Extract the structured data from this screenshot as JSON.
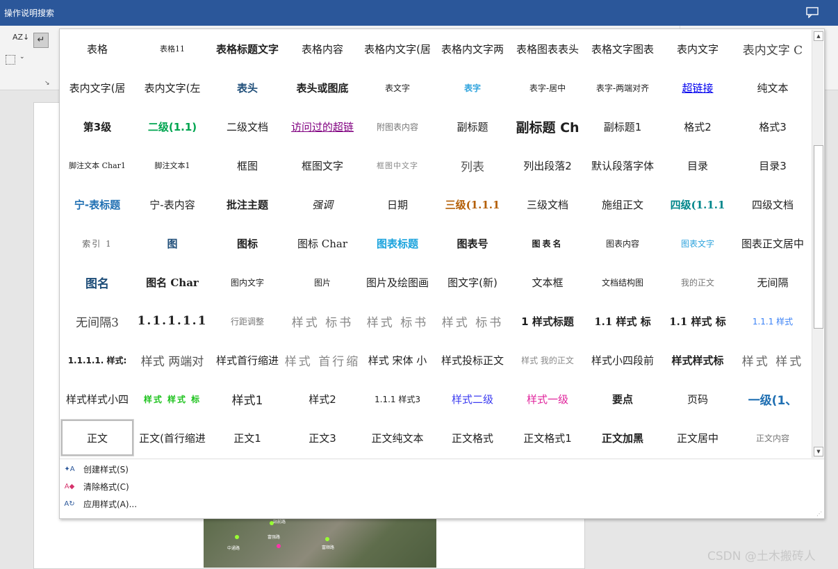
{
  "titlebar": {
    "title": "操作说明搜索",
    "comment_icon": "comment-icon"
  },
  "ribbon": {
    "sort_icon_text": "AZ↓",
    "pilcrow": "↵"
  },
  "colors": {
    "titlebar": "#2b579a",
    "link": "#0000ee",
    "visited": "#800080",
    "teal": "#00868b",
    "blue_heading": "#1f6fb2"
  },
  "styles": [
    "表格",
    "表格11",
    "表格标题文字",
    "表格内容",
    "表格内文字(居",
    "表格内文字两",
    "表格图表表头",
    "表格文字图表",
    "表内文字",
    "表内文字 C",
    "表内文字(居",
    "表内文字(左",
    "表头",
    "表头或图底",
    "表文字",
    "表字",
    "表字-居中",
    "表字-两端对齐",
    "超链接",
    "纯文本",
    "第3级",
    "二级(1.1)",
    "二级文档",
    "访问过的超链",
    "附图表内容",
    "副标题",
    "副标题 Ch",
    "副标题1",
    "格式2",
    "格式3",
    "脚注文本 Char1",
    "脚注文本1",
    "框图",
    "框图文字",
    "框图中文字",
    "列表",
    "列出段落2",
    "默认段落字体",
    "目录",
    "目录3",
    "宁-表标题",
    "宁-表内容",
    "批注主题",
    "强调",
    "日期",
    "三级(1.1.1",
    "三级文档",
    "施组正文",
    "四级(1.1.1",
    "四级文档",
    "索引 1",
    "图",
    "图标",
    "图标 Char",
    "图表标题",
    "图表号",
    "图表名",
    "图表内容",
    "图表文字",
    "图表正文居中",
    "图名",
    "图名 Char",
    "图内文字",
    "图片",
    "图片及绘图画",
    "图文字(新)",
    "文本框",
    "文档结构图",
    "我的正文",
    "无间隔",
    "无间隔3",
    "1.1.1.1.1",
    "行距调整",
    "样式 标书",
    "样式 标书",
    "样式 标书",
    "1 样式标题",
    "1.1 样式 标",
    "1.1 样式 标",
    "1.1.1 样式",
    "1.1.1.1. 样式:",
    "样式 两端对",
    "样式首行缩进",
    "样式 首行缩",
    "样式 宋体 小",
    "样式投标正文",
    "样式 我的正文",
    "样式小四段前",
    "样式样式标",
    "样式 样式",
    "样式样式小四",
    "样式 样式 标",
    "样式1",
    "样式2",
    "1.1.1 样式3",
    "样式二级",
    "样式一级",
    "要点",
    "页码",
    "一级(1、",
    "正文",
    "正文(首行缩进",
    "正文1",
    "正文3",
    "正文纯文本",
    "正文格式",
    "正文格式1",
    "正文加黑",
    "正文居中",
    "正文内容"
  ],
  "menu": [
    {
      "label": "创建样式(S)",
      "icon": "create-style-icon"
    },
    {
      "label": "清除格式(C)",
      "icon": "clear-format-icon"
    },
    {
      "label": "应用样式(A)...",
      "icon": "apply-style-icon"
    }
  ],
  "watermark": "CSDN @土木搬砖人",
  "map_labels": [
    "中通路",
    "站前路",
    "富强路",
    "富顺路"
  ]
}
